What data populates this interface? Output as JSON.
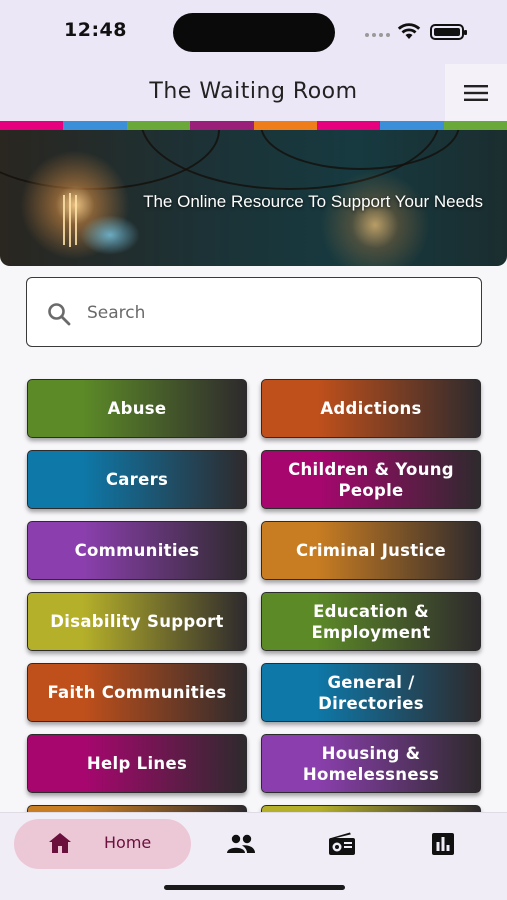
{
  "status_bar": {
    "time": "12:48"
  },
  "header": {
    "title": "The Waiting Room"
  },
  "stripe_colors": [
    "#e6007e",
    "#3b8fd9",
    "#6aa83a",
    "#9a1f78",
    "#ee7d1a",
    "#e6007e",
    "#3b8fd9",
    "#6aa83a"
  ],
  "hero": {
    "tagline": "The Online Resource To Support Your Needs"
  },
  "search": {
    "placeholder": "Search",
    "value": ""
  },
  "categories": [
    {
      "label": "Abuse",
      "color": "#5c8a27"
    },
    {
      "label": "Addictions",
      "color": "#c0501b"
    },
    {
      "label": "Carers",
      "color": "#0e78a8"
    },
    {
      "label": "Children & Young People",
      "color": "#a8066f"
    },
    {
      "label": "Communities",
      "color": "#8b3fae"
    },
    {
      "label": "Criminal Justice",
      "color": "#c97d22"
    },
    {
      "label": "Disability Support",
      "color": "#b5b02a"
    },
    {
      "label": "Education & Employment",
      "color": "#5c8a27"
    },
    {
      "label": "Faith Communities",
      "color": "#c0501b"
    },
    {
      "label": "General / Directories",
      "color": "#0e78a8"
    },
    {
      "label": "Help Lines",
      "color": "#a8066f"
    },
    {
      "label": "Housing & Homelessness",
      "color": "#8b3fae"
    },
    {
      "label": "",
      "color": "#c97d22"
    },
    {
      "label": "",
      "color": "#b5b02a"
    }
  ],
  "bottom_nav": {
    "items": [
      {
        "label": "Home",
        "icon": "home-icon",
        "active": true
      },
      {
        "label": "",
        "icon": "people-icon",
        "active": false
      },
      {
        "label": "",
        "icon": "radio-icon",
        "active": false
      },
      {
        "label": "",
        "icon": "bar-chart-icon",
        "active": false
      }
    ]
  }
}
